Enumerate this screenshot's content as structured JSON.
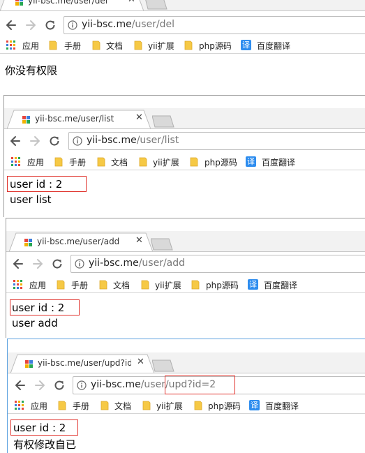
{
  "bookmarks": [
    {
      "label": "应用",
      "icon": "apps-grid-icon"
    },
    {
      "label": "手册",
      "icon": "folder-icon"
    },
    {
      "label": "文档",
      "icon": "folder-icon"
    },
    {
      "label": "yii扩展",
      "icon": "folder-icon"
    },
    {
      "label": "php源码",
      "icon": "folder-icon"
    },
    {
      "label": "百度翻译",
      "icon": "baidu-translate-icon",
      "icon_text": "译"
    }
  ],
  "windows": [
    {
      "tab_title": "yii-bsc.me/user/del",
      "url_host": "yii-bsc.me",
      "url_path": "/user/del",
      "content_line1": "你没有权限",
      "content_line2": ""
    },
    {
      "tab_title": "yii-bsc.me/user/list",
      "url_host": "yii-bsc.me",
      "url_path": "/user/list",
      "content_line1": "user id : 2",
      "content_line2": "user list"
    },
    {
      "tab_title": "yii-bsc.me/user/add",
      "url_host": "yii-bsc.me",
      "url_path": "/user/add",
      "content_line1": "user id : 2",
      "content_line2": "user add"
    },
    {
      "tab_title": "yii-bsc.me/user/upd?id",
      "url_host": "yii-bsc.me",
      "url_path": "/user/upd?id=2",
      "content_line1": "user id : 2",
      "content_line2": "有权修改自已"
    }
  ],
  "icon_names": {
    "back": "back-arrow-icon",
    "forward": "forward-arrow-icon",
    "reload": "reload-icon",
    "info": "info-icon",
    "favicon": "site-favicon-icon",
    "close": "close-icon"
  },
  "colors": {
    "highlight_box": "#e0322c",
    "favicon": [
      "#e8453c",
      "#3b7ddd",
      "#f2b200",
      "#27a853"
    ],
    "folder": "#f6c945",
    "baidu_blue": "#2e8def"
  }
}
